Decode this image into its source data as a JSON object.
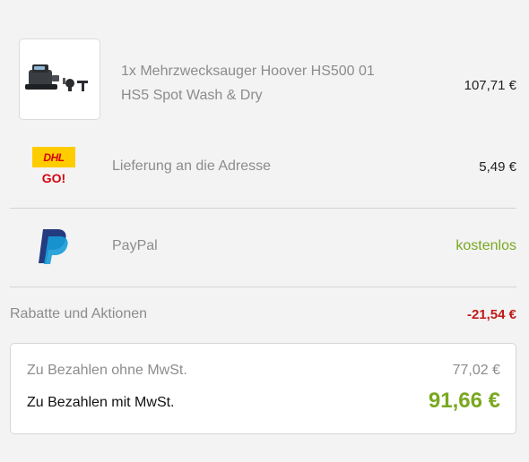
{
  "product": {
    "name": "1x Mehrzwecksauger Hoover HS500 01 HS5 Spot Wash & Dry",
    "price": "107,71 €",
    "image_icon": "vacuum-cleaner-icon"
  },
  "shipping": {
    "carrier_logo_text": "DHL",
    "carrier_sub_text": "GO!",
    "label": "Lieferung an die Adresse",
    "price": "5,49 €",
    "icon": "dhl-logo-icon"
  },
  "payment": {
    "label": "PayPal",
    "price": "kostenlos",
    "icon": "paypal-logo-icon"
  },
  "discounts": {
    "label": "Rabatte und Aktionen",
    "value": "-21,54 €"
  },
  "totals": {
    "net_label": "Zu Bezahlen ohne MwSt.",
    "net_value": "77,02 €",
    "gross_label": "Zu Bezahlen mit MwSt.",
    "gross_value": "91,66 €"
  },
  "colors": {
    "accent_green": "#7aa820",
    "discount_red": "#c11a1a",
    "dhl_yellow": "#ffcc00",
    "dhl_red": "#d40511",
    "paypal_dark": "#253b80",
    "paypal_light": "#179bd7"
  }
}
